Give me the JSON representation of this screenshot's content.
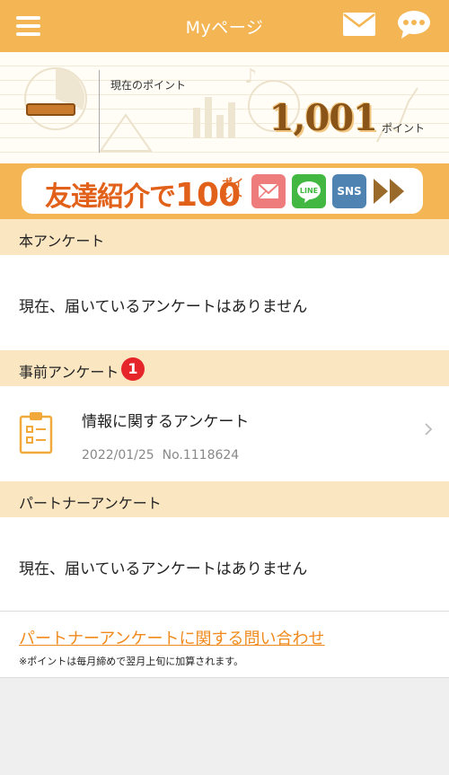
{
  "header": {
    "title": "Myページ",
    "menu_icon": "hamburger-menu-icon",
    "mail_icon": "envelope-icon",
    "chat_icon": "chat-bubble-icon",
    "color": "#f4b654"
  },
  "points": {
    "label": "現在のポイント",
    "value": "1,001",
    "unit": "ポイント"
  },
  "banner": {
    "text_main": "友達紹介で",
    "text_num": "100",
    "text_small": "ポイント",
    "mail_icon": "envelope-icon",
    "line_label": "LINE",
    "sns_label": "SNS",
    "arrow_icon": "double-arrow-right-icon"
  },
  "sections": {
    "main_survey": {
      "title": "本アンケート",
      "empty_message": "現在、届いているアンケートはありません"
    },
    "pre_survey": {
      "title": "事前アンケート",
      "badge": "1",
      "items": [
        {
          "title": "情報に関するアンケート",
          "date": "2022/01/25",
          "number": "No.1118624",
          "icon": "clipboard-icon"
        }
      ]
    },
    "partner_survey": {
      "title": "パートナーアンケート",
      "empty_message": "現在、届いているアンケートはありません"
    }
  },
  "footer": {
    "contact_link": "パートナーアンケートに関する問い合わせ",
    "note": "※ポイントは毎月締めで翌月上旬に加算されます。"
  },
  "colors": {
    "accent": "#f4b654",
    "section_bg": "#fbe6c2",
    "link": "#f08a1d",
    "badge": "#e5252a"
  }
}
